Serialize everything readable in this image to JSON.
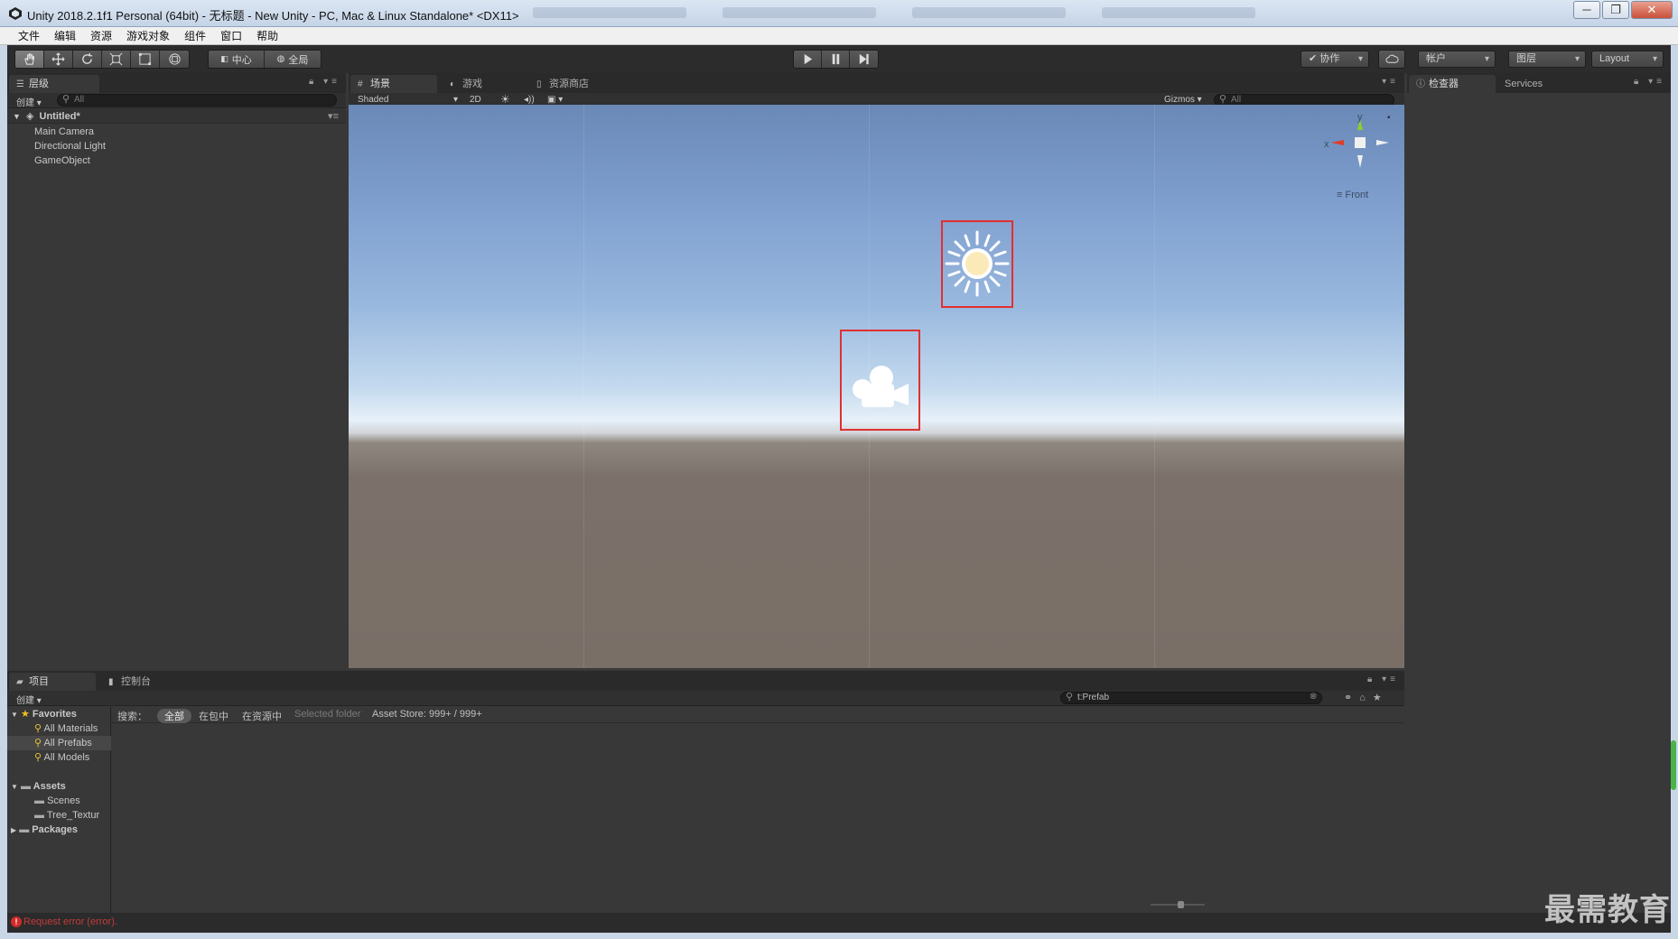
{
  "window": {
    "title": "Unity 2018.2.1f1 Personal (64bit) - 无标题 - New Unity - PC, Mac & Linux Standalone* <DX11>",
    "controls": [
      "─",
      "❐",
      "✕"
    ]
  },
  "menubar": {
    "items": [
      "文件",
      "编辑",
      "资源",
      "游戏对象",
      "组件",
      "窗口",
      "帮助"
    ]
  },
  "toolbar": {
    "transform_tools": [
      "hand-icon",
      "move-icon",
      "rotate-icon",
      "scale-icon",
      "rect-icon",
      "transform-icon"
    ],
    "pivot_label": "中心",
    "global_label": "全局",
    "collab_label": "协作",
    "account_label": "帐户",
    "layers_label": "图层",
    "layout_label": "Layout"
  },
  "hierarchy": {
    "tab_label": "层级",
    "create_label": "创建",
    "search_placeholder": "All",
    "scene_name": "Untitled*",
    "items": [
      "Main Camera",
      "Directional Light",
      "GameObject"
    ]
  },
  "scene": {
    "tabs": [
      "场景",
      "游戏",
      "资源商店"
    ],
    "shading_mode": "Shaded",
    "mode_2d": "2D",
    "gizmos_label": "Gizmos",
    "search_placeholder": "All",
    "orientation_label": "Front",
    "axis_x": "x",
    "axis_y": "y"
  },
  "inspector": {
    "tabs": [
      "检查器",
      "Services"
    ]
  },
  "project": {
    "tabs": [
      "项目",
      "控制台"
    ],
    "create_label": "创建",
    "search_value": "t:Prefab",
    "tree": {
      "favorites": "Favorites",
      "favorite_items": [
        "All Materials",
        "All Prefabs",
        "All Models"
      ],
      "assets": "Assets",
      "asset_items": [
        "Scenes",
        "Tree_Textur"
      ],
      "packages": "Packages"
    },
    "filter": {
      "label": "搜索：",
      "all": "全部",
      "in_packages": "在包中",
      "in_assets": "在资源中",
      "selected_folder": "Selected folder",
      "asset_store": "Asset Store: 999+ / 999+"
    }
  },
  "status": {
    "error_text": "Request error (error)."
  },
  "watermark": "最需教育",
  "colors": {
    "highlight": "#e03030",
    "editor_bg": "#383838",
    "error": "#c33b3b"
  }
}
